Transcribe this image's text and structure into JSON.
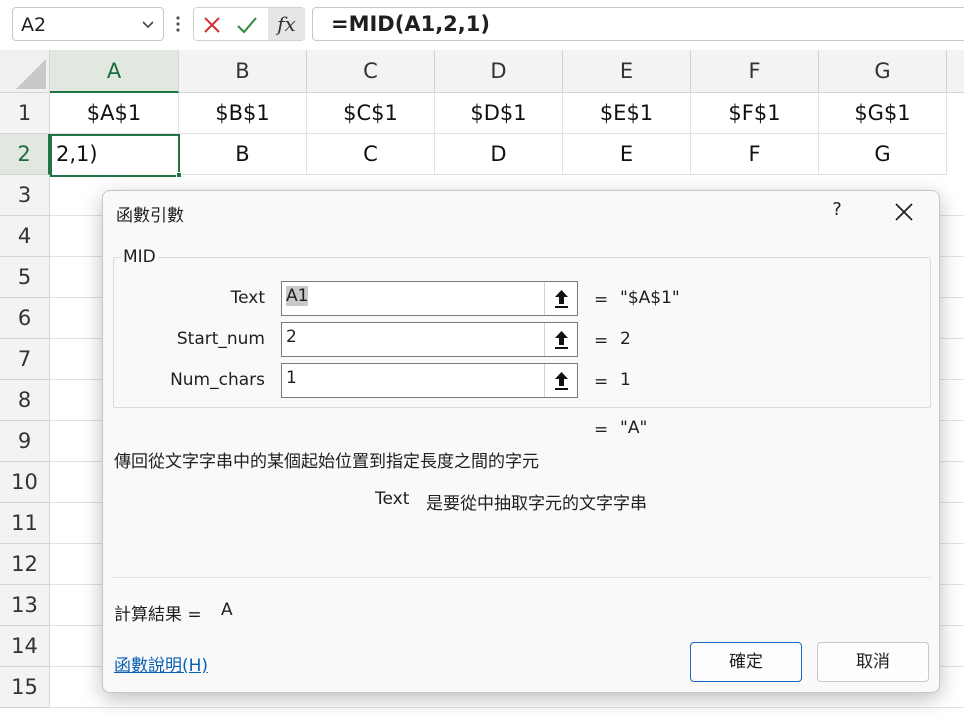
{
  "formula_bar": {
    "name_box": "A2",
    "fx_label": "fx",
    "formula": "=MID(A1,2,1)"
  },
  "grid": {
    "columns": [
      "A",
      "B",
      "C",
      "D",
      "E",
      "F",
      "G"
    ],
    "rows": [
      "1",
      "2",
      "3",
      "4",
      "5",
      "6",
      "7",
      "8",
      "9",
      "10",
      "11",
      "12",
      "13",
      "14",
      "15"
    ],
    "row1": [
      "$A$1",
      "$B$1",
      "$C$1",
      "$D$1",
      "$E$1",
      "$F$1",
      "$G$1"
    ],
    "row2": [
      "2,1)",
      "B",
      "C",
      "D",
      "E",
      "F",
      "G"
    ]
  },
  "dialog": {
    "title": "函數引數",
    "help_glyph": "?",
    "function_name": "MID",
    "args": [
      {
        "label": "Text",
        "value": "A1",
        "eq": "=",
        "result": "\"$A$1\""
      },
      {
        "label": "Start_num",
        "value": "2",
        "eq": "=",
        "result": "2"
      },
      {
        "label": "Num_chars",
        "value": "1",
        "eq": "=",
        "result": "1"
      }
    ],
    "overall_eq": "=",
    "overall_result": "\"A\"",
    "description": "傳回從文字字串中的某個起始位置到指定長度之間的字元",
    "arg_desc_name": "Text",
    "arg_desc_text": "是要從中抽取字元的文字字串",
    "result_label": "計算結果 =",
    "result_value": "A",
    "help_link": "函數說明(H)",
    "ok_label": "確定",
    "cancel_label": "取消"
  },
  "colors": {
    "accent": "#217346",
    "link": "#0a5fb4",
    "cancel_red": "#d13438",
    "confirm_green": "#2e8b3a"
  }
}
